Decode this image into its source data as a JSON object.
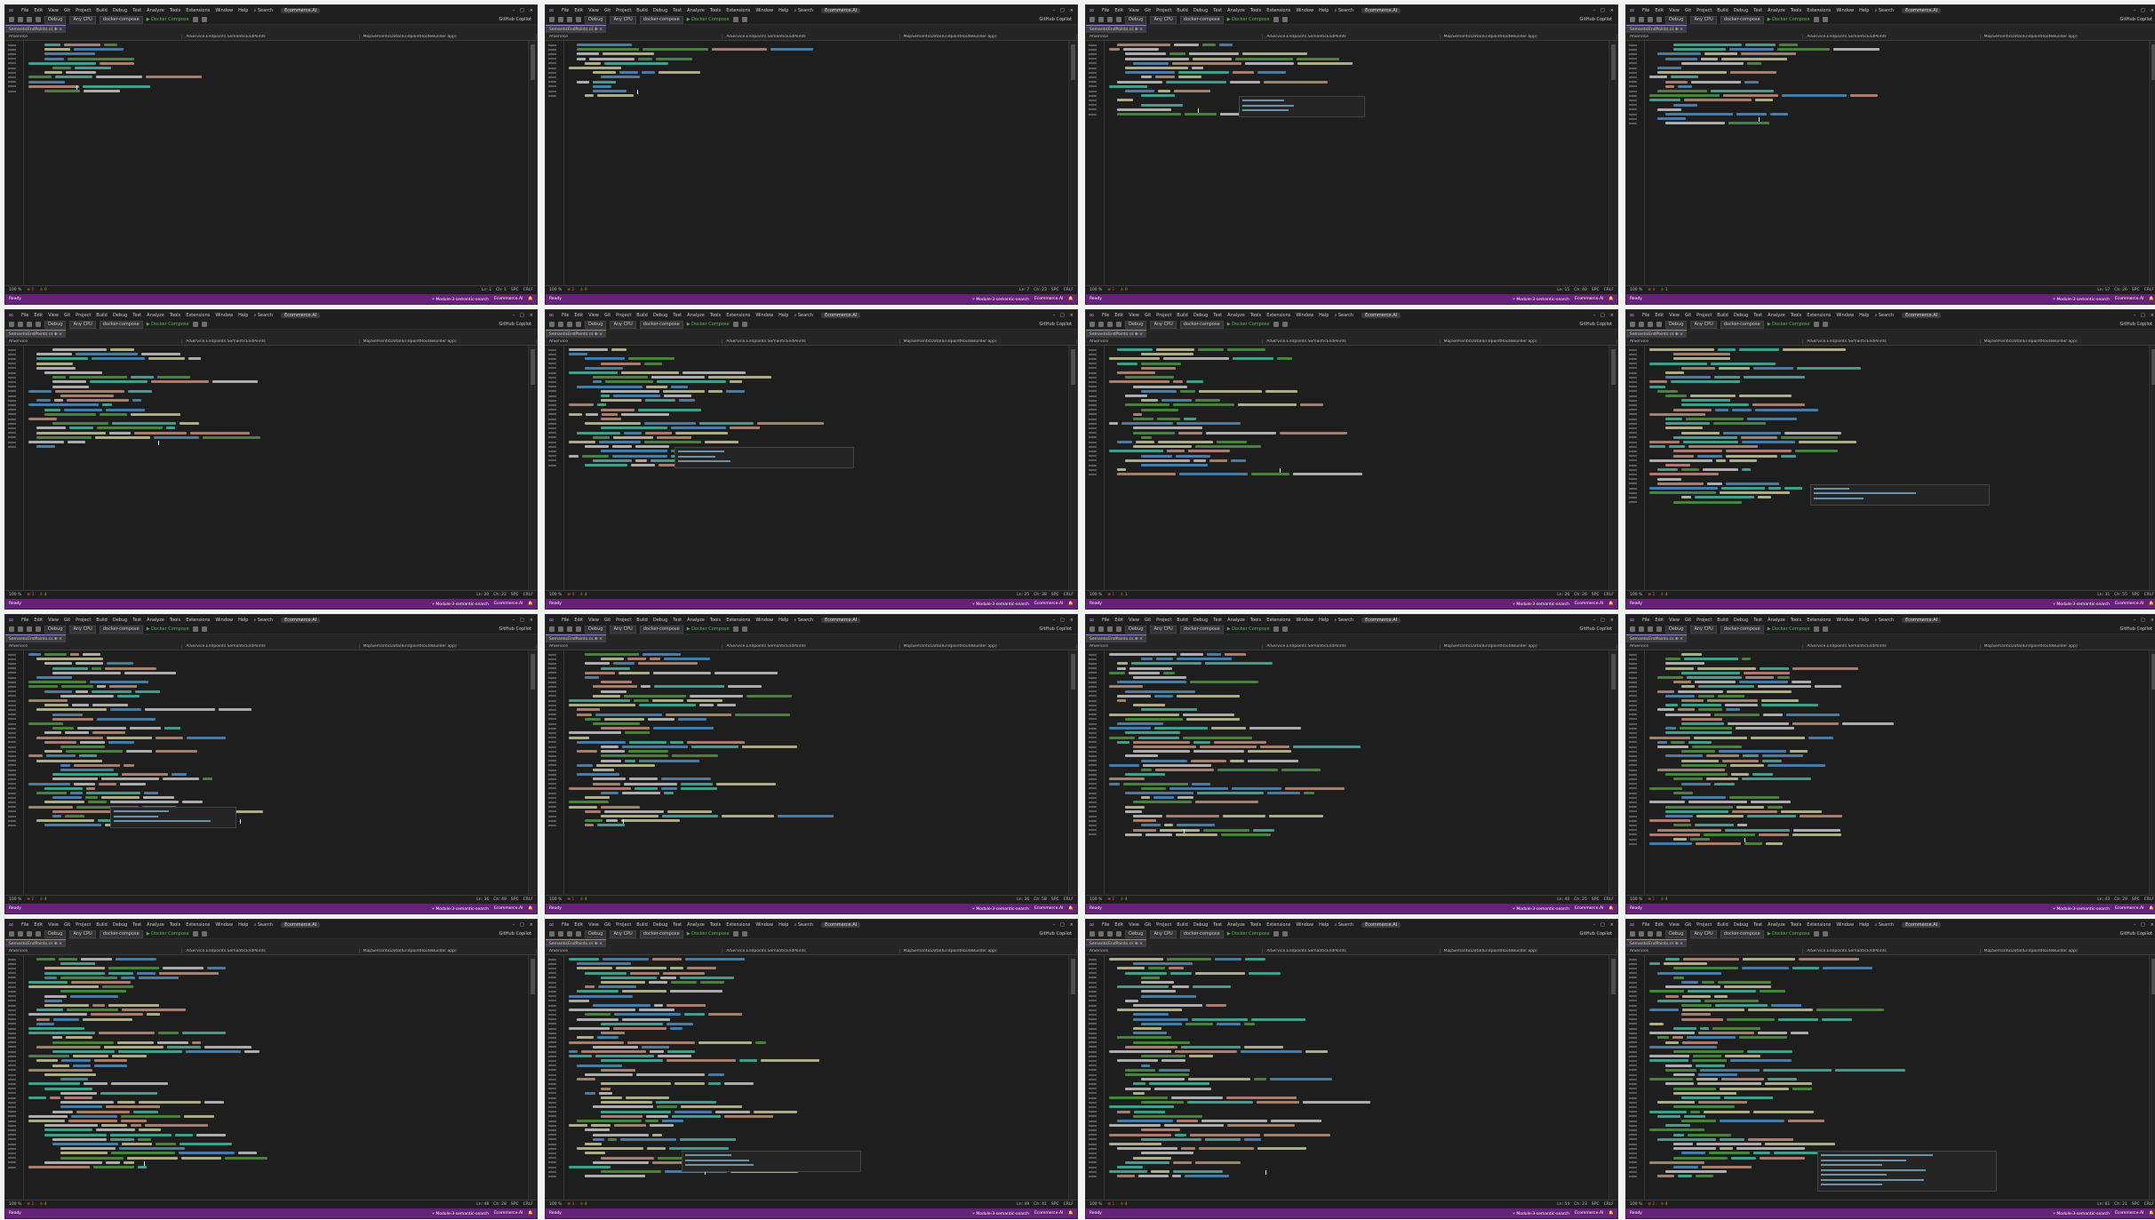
{
  "menu": {
    "items": [
      "File",
      "Edit",
      "View",
      "Git",
      "Project",
      "Build",
      "Debug",
      "Test",
      "Analyze",
      "Tools",
      "Extensions",
      "Window",
      "Help"
    ],
    "search_label": "Search",
    "solution_name": "Ecommerce.AI"
  },
  "toolbar": {
    "config": "Debug",
    "platform": "Any CPU",
    "launch_target": "docker-compose",
    "run_label": "Docker Compose",
    "copilot_label": "GitHub Copilot"
  },
  "tab": {
    "label": "SemanticEndPoints.cs"
  },
  "navbar": {
    "project": "AIService",
    "class": "AIService.Endpoints.SemanticEndPoints",
    "method": "MapSemanticData(IEndpointRouteBuilder app)"
  },
  "status": {
    "no_issues": "No issues found",
    "zoom": "100 %",
    "encoding": "SPC",
    "line_ending": "CRLF",
    "ready": "Ready",
    "repo_branch": "Ecommerce.AI",
    "git_module": "Module-3-semantic-search"
  },
  "frames": [
    {
      "id": 1,
      "ln": "Ln: 1",
      "ch": "Ch: 1",
      "errors": "0",
      "warnings": "0",
      "code_lines": 11,
      "popup": false
    },
    {
      "id": 2,
      "ln": "Ln: 7",
      "ch": "Ch: 23",
      "errors": "2",
      "warnings": "0",
      "code_lines": 12,
      "popup": false
    },
    {
      "id": 3,
      "ln": "Ln: 15",
      "ch": "Ch: 40",
      "errors": "1",
      "warnings": "0",
      "code_lines": 16,
      "popup": true
    },
    {
      "id": 4,
      "ln": "Ln: 17",
      "ch": "Ch: 26",
      "errors": "4",
      "warnings": "1",
      "code_lines": 18,
      "popup": false
    },
    {
      "id": 5,
      "ln": "Ln: 20",
      "ch": "Ch: 22",
      "errors": "3",
      "warnings": "4",
      "code_lines": 22,
      "popup": false
    },
    {
      "id": 6,
      "ln": "Ln: 25",
      "ch": "Ch: 38",
      "errors": "4",
      "warnings": "4",
      "code_lines": 26,
      "popup": true
    },
    {
      "id": 7,
      "ln": "Ln: 26",
      "ch": "Ch: 26",
      "errors": "1",
      "warnings": "1",
      "code_lines": 28,
      "popup": false
    },
    {
      "id": 8,
      "ln": "Ln: 31",
      "ch": "Ch: 55",
      "errors": "2",
      "warnings": "4",
      "code_lines": 34,
      "popup": true
    },
    {
      "id": 9,
      "ln": "Ln: 36",
      "ch": "Ch: 49",
      "errors": "2",
      "warnings": "4",
      "code_lines": 38,
      "popup": true
    },
    {
      "id": 10,
      "ln": "Ln: 36",
      "ch": "Ch: 58",
      "errors": "1",
      "warnings": "4",
      "code_lines": 38,
      "popup": false
    },
    {
      "id": 11,
      "ln": "Ln: 40",
      "ch": "Ch: 25",
      "errors": "2",
      "warnings": "4",
      "code_lines": 40,
      "popup": false
    },
    {
      "id": 12,
      "ln": "Ln: 43",
      "ch": "Ch: 29",
      "errors": "1",
      "warnings": "4",
      "code_lines": 42,
      "popup": false
    },
    {
      "id": 13,
      "ln": "Ln: 48",
      "ch": "Ch: 28",
      "errors": "2",
      "warnings": "4",
      "code_lines": 46,
      "popup": false
    },
    {
      "id": 14,
      "ln": "Ln: 49",
      "ch": "Ch: 41",
      "errors": "3",
      "warnings": "4",
      "code_lines": 48,
      "popup": true
    },
    {
      "id": 15,
      "ln": "Ln: 54",
      "ch": "Ch: 23",
      "errors": "1",
      "warnings": "4",
      "code_lines": 50,
      "popup": false
    },
    {
      "id": 16,
      "ln": "Ln: 61",
      "ch": "Ch: 21",
      "errors": "2",
      "warnings": "4",
      "code_lines": 52,
      "popup": true
    }
  ],
  "colors": {
    "keyword": "#569cd6",
    "type": "#4ec9b0",
    "string": "#d69d85",
    "comment": "#57a64a",
    "identifier": "#dcdcdc",
    "method": "#dcdcaa",
    "accent": "#68217a"
  }
}
